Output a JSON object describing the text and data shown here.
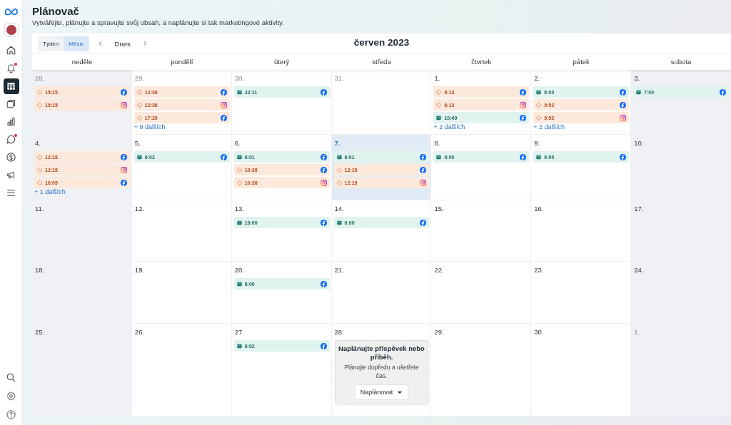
{
  "sidebar": {
    "items": [
      {
        "selected": false,
        "badge": false
      },
      {
        "selected": false,
        "badge": true
      },
      {
        "selected": true,
        "badge": false
      },
      {
        "selected": false,
        "badge": false
      },
      {
        "selected": false,
        "badge": false
      },
      {
        "selected": false,
        "badge": true
      },
      {
        "selected": false,
        "badge": false
      },
      {
        "selected": false,
        "badge": false
      },
      {
        "selected": false,
        "badge": false
      }
    ]
  },
  "header": {
    "title": "Plánovač",
    "subtitle": "Vytvářejte, plánujte a spravujte svůj obsah, a naplánujte si tak marketingové aktivity."
  },
  "toolbar": {
    "views": [
      {
        "label": "Týden",
        "selected": false
      },
      {
        "label": "Měsíc",
        "selected": true
      }
    ],
    "today": "Dnes",
    "month": "červen 2023"
  },
  "weekdays": [
    {
      "label": "neděle",
      "weekend": true
    },
    {
      "label": "pondělí",
      "weekend": false
    },
    {
      "label": "úterý",
      "weekend": false
    },
    {
      "label": "středa",
      "weekend": false
    },
    {
      "label": "čtvrtek",
      "weekend": false
    },
    {
      "label": "pátek",
      "weekend": false
    },
    {
      "label": "sobota",
      "weekend": true
    }
  ],
  "cells": [
    {
      "date": "28.",
      "muted": true,
      "today": false,
      "events": [
        {
          "kind": "scheduled-facebook",
          "time": "15:15"
        },
        {
          "kind": "scheduled-instagram",
          "time": "15:15"
        }
      ]
    },
    {
      "date": "29.",
      "muted": true,
      "today": false,
      "events": [
        {
          "kind": "scheduled-facebook",
          "time": "12:36"
        },
        {
          "kind": "scheduled-instagram",
          "time": "12:36"
        },
        {
          "kind": "scheduled-facebook",
          "time": "17:29"
        }
      ],
      "more": "+ 9 dalších"
    },
    {
      "date": "30.",
      "muted": true,
      "today": false,
      "events": [
        {
          "kind": "published-facebook",
          "time": "22:11"
        }
      ]
    },
    {
      "date": "31.",
      "muted": true,
      "today": false
    },
    {
      "date": "1.",
      "muted": false,
      "today": false,
      "events": [
        {
          "kind": "scheduled-facebook",
          "time": "6:13"
        },
        {
          "kind": "scheduled-instagram",
          "time": "6:13"
        },
        {
          "kind": "published-facebook",
          "time": "10:49"
        }
      ],
      "more": "+ 2 dalších"
    },
    {
      "date": "2.",
      "muted": false,
      "today": false,
      "events": [
        {
          "kind": "published-facebook",
          "time": "6:00"
        },
        {
          "kind": "scheduled-facebook",
          "time": "9:52"
        },
        {
          "kind": "scheduled-instagram",
          "time": "9:52"
        }
      ],
      "more": "+ 2 dalších"
    },
    {
      "date": "3.",
      "muted": false,
      "today": false,
      "events": [
        {
          "kind": "published-facebook",
          "time": "7:00"
        }
      ]
    },
    {
      "date": "4.",
      "muted": false,
      "today": false,
      "events": [
        {
          "kind": "scheduled-facebook",
          "time": "12:18"
        },
        {
          "kind": "scheduled-instagram",
          "time": "12:18"
        },
        {
          "kind": "scheduled-facebook",
          "time": "16:05"
        }
      ],
      "more": "+ 1 dalších"
    },
    {
      "date": "5.",
      "muted": false,
      "today": false,
      "events": [
        {
          "kind": "published-facebook",
          "time": "6:02"
        }
      ]
    },
    {
      "date": "6.",
      "muted": false,
      "today": false,
      "events": [
        {
          "kind": "published-facebook",
          "time": "6:01"
        },
        {
          "kind": "scheduled-facebook",
          "time": "10:38"
        },
        {
          "kind": "scheduled-instagram",
          "time": "10:38"
        }
      ]
    },
    {
      "date": "7.",
      "muted": false,
      "today": true,
      "events": [
        {
          "kind": "published-facebook",
          "time": "6:01"
        },
        {
          "kind": "scheduled-facebook",
          "time": "12:15"
        },
        {
          "kind": "scheduled-instagram",
          "time": "12:15"
        }
      ]
    },
    {
      "date": "8.",
      "muted": false,
      "today": false,
      "events": [
        {
          "kind": "published-facebook",
          "time": "6:00"
        }
      ]
    },
    {
      "date": "9.",
      "muted": false,
      "today": false,
      "events": [
        {
          "kind": "published-facebook",
          "time": "6:00"
        }
      ]
    },
    {
      "date": "10.",
      "muted": false,
      "today": false
    },
    {
      "date": "11.",
      "muted": false,
      "today": false
    },
    {
      "date": "12.",
      "muted": false,
      "today": false
    },
    {
      "date": "13.",
      "muted": false,
      "today": false,
      "events": [
        {
          "kind": "published-facebook",
          "time": "19:00"
        }
      ]
    },
    {
      "date": "14.",
      "muted": false,
      "today": false,
      "events": [
        {
          "kind": "published-facebook",
          "time": "6:00"
        }
      ]
    },
    {
      "date": "15.",
      "muted": false,
      "today": false
    },
    {
      "date": "16.",
      "muted": false,
      "today": false
    },
    {
      "date": "17.",
      "muted": false,
      "today": false
    },
    {
      "date": "18.",
      "muted": false,
      "today": false
    },
    {
      "date": "19.",
      "muted": false,
      "today": false
    },
    {
      "date": "20.",
      "muted": false,
      "today": false,
      "events": [
        {
          "kind": "published-facebook",
          "time": "6:00"
        }
      ]
    },
    {
      "date": "21.",
      "muted": false,
      "today": false
    },
    {
      "date": "22.",
      "muted": false,
      "today": false
    },
    {
      "date": "23.",
      "muted": false,
      "today": false
    },
    {
      "date": "24.",
      "muted": false,
      "today": false
    },
    {
      "date": "25.",
      "muted": false,
      "today": false
    },
    {
      "date": "26.",
      "muted": false,
      "today": false
    },
    {
      "date": "27.",
      "muted": false,
      "today": false,
      "events": [
        {
          "kind": "published-facebook",
          "time": "6:02"
        }
      ]
    },
    {
      "date": "28.",
      "muted": false,
      "today": false,
      "prompt": {
        "title": "Naplánujte příspěvek nebo příběh.",
        "text": "Plánujte dopředu a ušetřete čas.",
        "button": "Naplánovat"
      }
    },
    {
      "date": "29.",
      "muted": false,
      "today": false
    },
    {
      "date": "30.",
      "muted": false,
      "today": false
    },
    {
      "date": "1.",
      "muted": true,
      "today": false
    }
  ]
}
